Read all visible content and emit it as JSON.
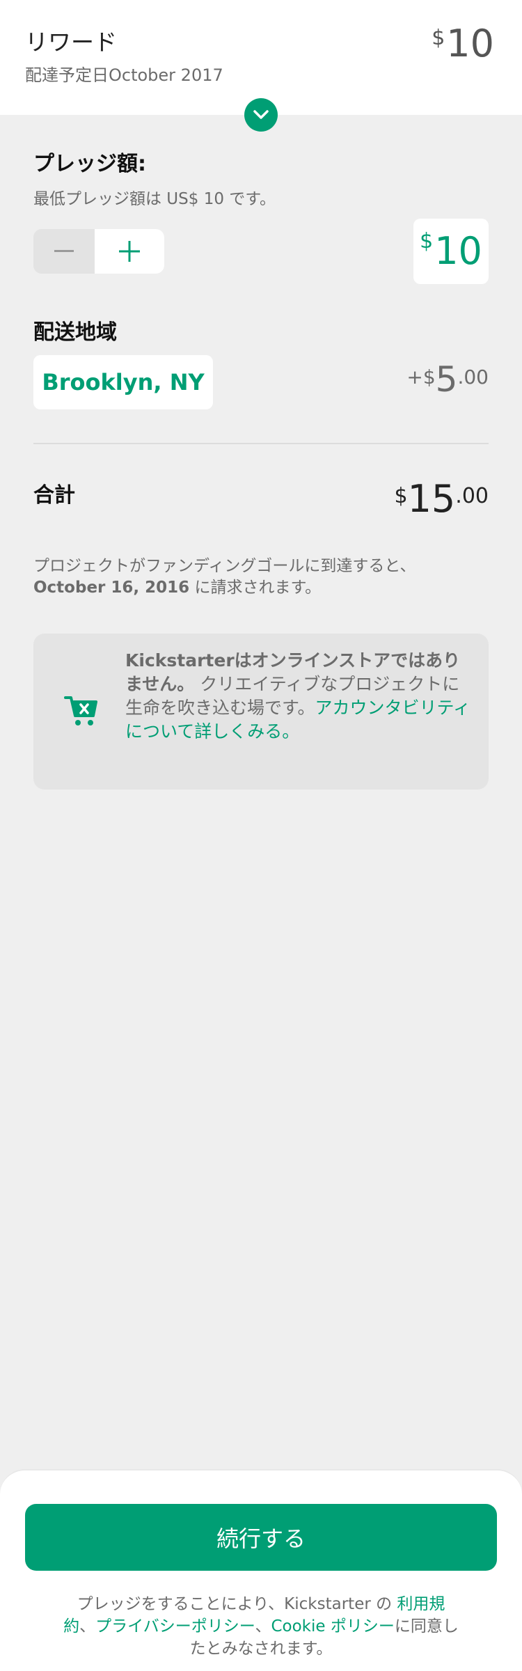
{
  "header": {
    "title": "リワード",
    "delivery": "配達予定日October 2017",
    "price_symbol": "$",
    "price_amount": "10"
  },
  "pledge": {
    "label": "プレッジ額:",
    "minimum_text": "最低プレッジ額は US$ 10 です。",
    "minus_icon": "minus-icon",
    "plus_icon": "plus-icon",
    "amount_symbol": "$",
    "amount_value": "10"
  },
  "shipping": {
    "label": "配送地域",
    "location": "Brooklyn, NY",
    "price_prefix": "+$",
    "price_whole": "5",
    "price_decimal": ".00"
  },
  "total": {
    "label": "合計",
    "symbol": "$",
    "whole": "15",
    "decimal": ".00"
  },
  "charge_notice": {
    "line1": "プロジェクトがファンディングゴールに到達すると、",
    "date": "October 16, 2016",
    "line2_suffix": " に請求されます。"
  },
  "notice": {
    "icon": "cart-x-icon",
    "bold_text": "Kickstarterはオンラインストアではありません。",
    "body_text": "クリエイティブなプロジェクトに生命を吹き込む場です。",
    "link_text": "アカウンタビリティについて詳しくみる。"
  },
  "footer": {
    "continue_label": "続行する",
    "legal_prefix": "プレッジをすることにより、Kickstarter の ",
    "terms_link": "利用規約",
    "separator1": "、",
    "privacy_link": "プライバシーポリシー",
    "separator2": "、",
    "cookie_link": "Cookie ポリシー",
    "legal_suffix": "に同意したとみなされます。"
  },
  "colors": {
    "accent": "#009e74",
    "background": "#efefef",
    "muted_text": "#6b6b6b"
  }
}
